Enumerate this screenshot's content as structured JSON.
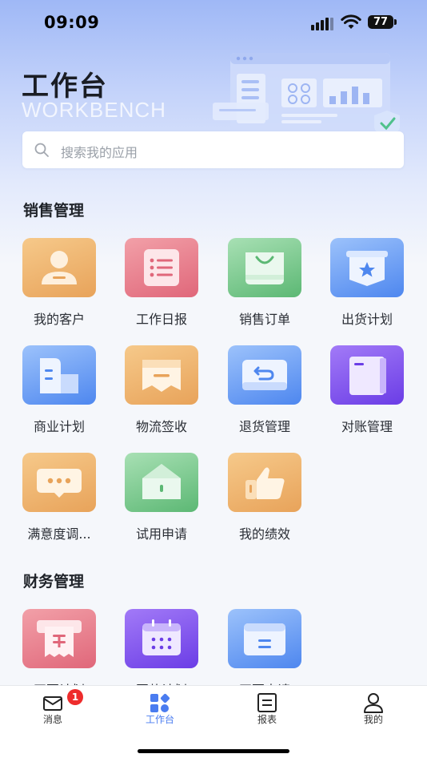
{
  "status": {
    "time": "09:09",
    "battery": "77"
  },
  "header": {
    "title": "工作台",
    "subtitle": "WORKBENCH"
  },
  "search": {
    "placeholder": "搜索我的应用"
  },
  "sections": [
    {
      "title": "销售管理",
      "items": [
        {
          "label": "我的客户",
          "icon": "user-icon",
          "color": "orange"
        },
        {
          "label": "工作日报",
          "icon": "list-icon",
          "color": "red"
        },
        {
          "label": "销售订单",
          "icon": "shopping-bag-icon",
          "color": "green"
        },
        {
          "label": "出货计划",
          "icon": "star-box-icon",
          "color": "blue"
        },
        {
          "label": "商业计划",
          "icon": "building-icon",
          "color": "blue"
        },
        {
          "label": "物流签收",
          "icon": "envelope-icon",
          "color": "orange"
        },
        {
          "label": "退货管理",
          "icon": "return-icon",
          "color": "blue"
        },
        {
          "label": "对账管理",
          "icon": "book-icon",
          "color": "purple"
        },
        {
          "label": "满意度调...",
          "icon": "chat-icon",
          "color": "orange"
        },
        {
          "label": "试用申请",
          "icon": "house-icon",
          "color": "green"
        },
        {
          "label": "我的绩效",
          "icon": "thumbs-up-icon",
          "color": "orange"
        }
      ]
    },
    {
      "title": "财务管理",
      "items": [
        {
          "label": "开票计划",
          "icon": "invoice-icon",
          "color": "red"
        },
        {
          "label": "回款计划",
          "icon": "calendar-icon",
          "color": "purple"
        },
        {
          "label": "开票申请",
          "icon": "card-icon",
          "color": "blue"
        }
      ]
    }
  ],
  "tabs": [
    {
      "label": "消息",
      "icon": "message-icon",
      "badge": "1"
    },
    {
      "label": "工作台",
      "icon": "workbench-icon",
      "active": true
    },
    {
      "label": "报表",
      "icon": "report-icon"
    },
    {
      "label": "我的",
      "icon": "profile-icon"
    }
  ],
  "colors": {
    "accent": "#4a7cf0",
    "badge": "#ee2c2c"
  }
}
